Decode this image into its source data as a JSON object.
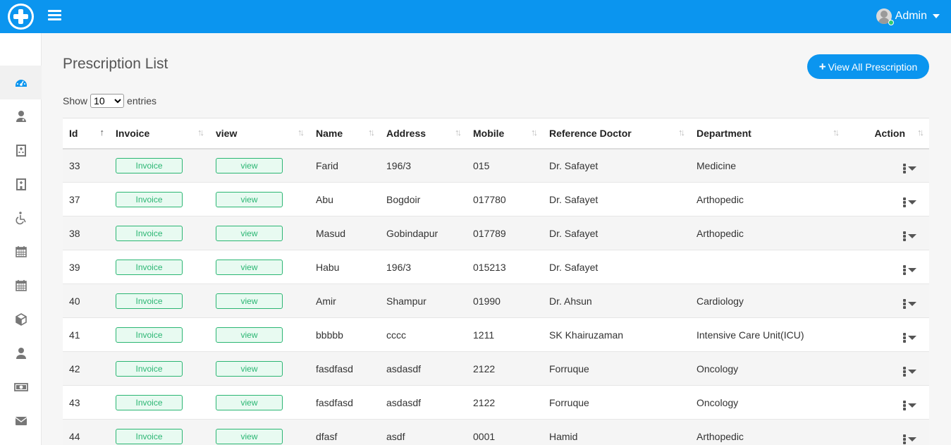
{
  "header": {
    "user_name": "Admin",
    "brand_color": "#0b95ef"
  },
  "sidebar": {
    "items": [
      {
        "icon": "dashboard-icon",
        "active": true
      },
      {
        "icon": "doctor-icon"
      },
      {
        "icon": "hospital-icon"
      },
      {
        "icon": "building-icon"
      },
      {
        "icon": "wheelchair-icon"
      },
      {
        "icon": "calendar-icon"
      },
      {
        "icon": "calendar-alt-icon"
      },
      {
        "icon": "box-icon"
      },
      {
        "icon": "user-icon"
      },
      {
        "icon": "money-icon"
      },
      {
        "icon": "envelope-icon"
      }
    ]
  },
  "page": {
    "title": "Prescription List",
    "view_all_label": "View All Prescription",
    "show_label": "Show",
    "entries_label": "entries",
    "entries_value": "10"
  },
  "table": {
    "columns": [
      "Id",
      "Invoice",
      "view",
      "Name",
      "Address",
      "Mobile",
      "Reference Doctor",
      "Department",
      "Action"
    ],
    "invoice_label": "Invoice",
    "view_label": "view",
    "rows": [
      {
        "id": "33",
        "name": "Farid",
        "address": "196/3",
        "mobile": "015",
        "doctor": "Dr. Safayet",
        "department": "Medicine"
      },
      {
        "id": "37",
        "name": "Abu",
        "address": "Bogdoir",
        "mobile": "017780",
        "doctor": "Dr. Safayet",
        "department": "Arthopedic"
      },
      {
        "id": "38",
        "name": "Masud",
        "address": "Gobindapur",
        "mobile": "017789",
        "doctor": "Dr. Safayet",
        "department": "Arthopedic"
      },
      {
        "id": "39",
        "name": "Habu",
        "address": "196/3",
        "mobile": "015213",
        "doctor": "Dr. Safayet",
        "department": ""
      },
      {
        "id": "40",
        "name": "Amir",
        "address": "Shampur",
        "mobile": "01990",
        "doctor": "Dr. Ahsun",
        "department": "Cardiology"
      },
      {
        "id": "41",
        "name": "bbbbb",
        "address": "cccc",
        "mobile": "1211",
        "doctor": "SK Khairuzaman",
        "department": "Intensive Care Unit(ICU)"
      },
      {
        "id": "42",
        "name": "fasdfasd",
        "address": "asdasdf",
        "mobile": "2122",
        "doctor": "Forruque",
        "department": "Oncology"
      },
      {
        "id": "43",
        "name": "fasdfasd",
        "address": "asdasdf",
        "mobile": "2122",
        "doctor": "Forruque",
        "department": "Oncology"
      },
      {
        "id": "44",
        "name": "dfasf",
        "address": "asdf",
        "mobile": "0001",
        "doctor": "Hamid",
        "department": "Arthopedic"
      }
    ]
  }
}
